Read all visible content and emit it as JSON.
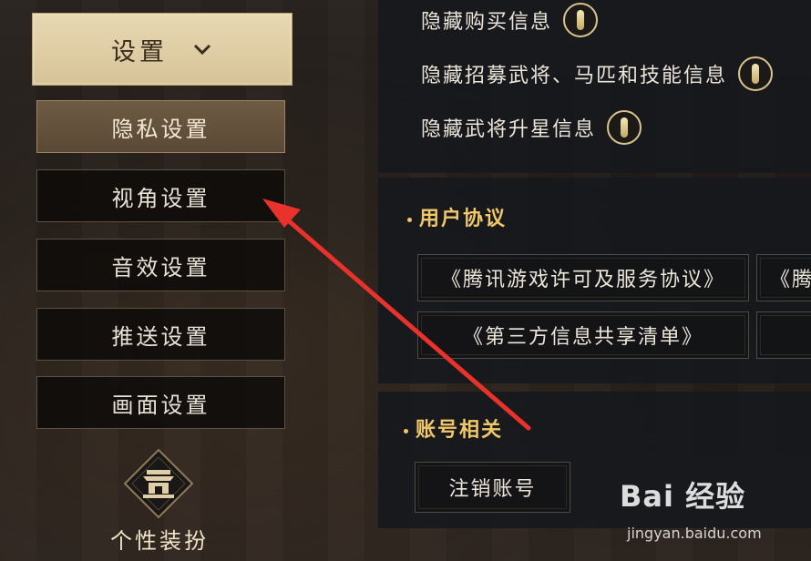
{
  "sidebar": {
    "header_label": "设置",
    "items": [
      {
        "label": "隐私设置"
      },
      {
        "label": "视角设置"
      },
      {
        "label": "音效设置"
      },
      {
        "label": "推送设置"
      },
      {
        "label": "画面设置"
      }
    ],
    "costume_label": "个性装扮"
  },
  "privacy": {
    "rows": [
      {
        "label": "隐藏购买信息"
      },
      {
        "label": "隐藏招募武将、马匹和技能信息"
      },
      {
        "label": "隐藏武将升星信息"
      }
    ]
  },
  "agreement": {
    "title": "用户协议",
    "links": [
      {
        "label": "《腾讯游戏许可及服务协议》"
      },
      {
        "label": "《腾"
      },
      {
        "label": "《第三方信息共享清单》"
      },
      {
        "label": ""
      }
    ]
  },
  "account": {
    "title": "账号相关",
    "cancel_label": "注销账号"
  },
  "watermark": {
    "brand": "Bai 经验",
    "url": "jingyan.baidu.com"
  },
  "colors": {
    "accent_gold": "#f0c86a",
    "active_tab": "#6e5b43",
    "arrow": "#e8322b"
  }
}
